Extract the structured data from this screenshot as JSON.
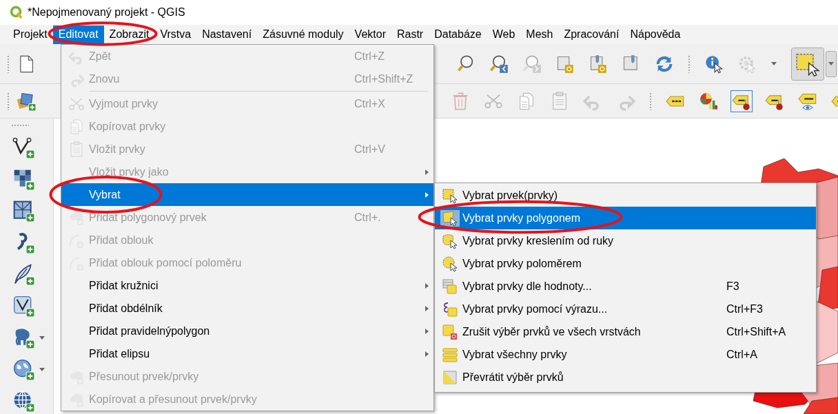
{
  "window": {
    "title": "*Nepojmenovaný projekt - QGIS"
  },
  "menubar": [
    {
      "label": "Projekt",
      "selected": false,
      "circled": false
    },
    {
      "label": "Editovat",
      "selected": true,
      "circled": true
    },
    {
      "label": "Zobrazit",
      "selected": false,
      "circled": false
    },
    {
      "label": "Vrstva",
      "selected": false,
      "circled": false
    },
    {
      "label": "Nastavení",
      "selected": false,
      "circled": false
    },
    {
      "label": "Zásuvné moduly",
      "selected": false,
      "circled": false
    },
    {
      "label": "Vektor",
      "selected": false,
      "circled": false
    },
    {
      "label": "Rastr",
      "selected": false,
      "circled": false
    },
    {
      "label": "Databáze",
      "selected": false,
      "circled": false
    },
    {
      "label": "Web",
      "selected": false,
      "circled": false
    },
    {
      "label": "Mesh",
      "selected": false,
      "circled": false
    },
    {
      "label": "Zpracování",
      "selected": false,
      "circled": false
    },
    {
      "label": "Nápověda",
      "selected": false,
      "circled": false
    }
  ],
  "edit_menu": {
    "items": [
      {
        "kind": "action",
        "label": "Zpět",
        "shortcut": "Ctrl+Z",
        "disabled": true,
        "submenu": false,
        "selected": false,
        "circled": false
      },
      {
        "kind": "action",
        "label": "Znovu",
        "shortcut": "Ctrl+Shift+Z",
        "disabled": true,
        "submenu": false,
        "selected": false,
        "circled": false
      },
      {
        "kind": "separator"
      },
      {
        "kind": "action",
        "label": "Vyjmout prvky",
        "shortcut": "Ctrl+X",
        "disabled": true,
        "submenu": false,
        "selected": false,
        "circled": false
      },
      {
        "kind": "action",
        "label": "Kopírovat prvky",
        "disabled": true,
        "submenu": false,
        "selected": false,
        "circled": false
      },
      {
        "kind": "action",
        "label": "Vložit prvky",
        "shortcut": "Ctrl+V",
        "disabled": true,
        "submenu": false,
        "selected": false,
        "circled": false
      },
      {
        "kind": "action",
        "label": "Vložit prvky jako",
        "disabled": true,
        "submenu": true,
        "selected": false,
        "circled": false
      },
      {
        "kind": "action",
        "label": "Vybrat",
        "disabled": false,
        "submenu": true,
        "selected": true,
        "circled": true
      },
      {
        "kind": "action",
        "label": "Přidat polygonový prvek",
        "shortcut": "Ctrl+.",
        "disabled": true,
        "submenu": false,
        "selected": false,
        "circled": false
      },
      {
        "kind": "action",
        "label": "Přidat oblouk",
        "disabled": true,
        "submenu": false,
        "selected": false,
        "circled": false
      },
      {
        "kind": "action",
        "label": "Přidat oblouk pomocí poloměru",
        "disabled": true,
        "submenu": false,
        "selected": false,
        "circled": false
      },
      {
        "kind": "action",
        "label": "Přidat kružnici",
        "disabled": false,
        "submenu": true,
        "selected": false,
        "circled": false
      },
      {
        "kind": "action",
        "label": "Přidat obdélník",
        "disabled": false,
        "submenu": true,
        "selected": false,
        "circled": false
      },
      {
        "kind": "action",
        "label": "Přidat pravidelnýpolygon",
        "disabled": false,
        "submenu": true,
        "selected": false,
        "circled": false
      },
      {
        "kind": "action",
        "label": "Přidat elipsu",
        "disabled": false,
        "submenu": true,
        "selected": false,
        "circled": false
      },
      {
        "kind": "action",
        "label": "Přesunout prvek/prvky",
        "disabled": true,
        "submenu": false,
        "selected": false,
        "circled": false
      },
      {
        "kind": "action",
        "label": "Kopírovat a přesunout prvek/prvky",
        "disabled": true,
        "submenu": false,
        "selected": false,
        "circled": false
      }
    ]
  },
  "select_submenu": {
    "items": [
      {
        "kind": "action",
        "label": "Vybrat prvek(prvky)",
        "disabled": false,
        "submenu": false,
        "selected": false,
        "circled": false
      },
      {
        "kind": "action",
        "label": "Vybrat prvky polygonem",
        "disabled": false,
        "submenu": false,
        "selected": true,
        "circled": true
      },
      {
        "kind": "action",
        "label": "Vybrat prvky kreslením od ruky",
        "disabled": false,
        "submenu": false,
        "selected": false,
        "circled": false
      },
      {
        "kind": "action",
        "label": "Vybrat prvky poloměrem",
        "disabled": false,
        "submenu": false,
        "selected": false,
        "circled": false
      },
      {
        "kind": "action",
        "label": "Vybrat prvky dle hodnoty...",
        "shortcut": "F3",
        "disabled": false,
        "submenu": false,
        "selected": false,
        "circled": false
      },
      {
        "kind": "action",
        "label": "Vybrat prvky pomocí výrazu...",
        "shortcut": "Ctrl+F3",
        "disabled": false,
        "submenu": false,
        "selected": false,
        "circled": false
      },
      {
        "kind": "action",
        "label": "Zrušit výběr prvků ve všech vrstvách",
        "shortcut": "Ctrl+Shift+A",
        "disabled": false,
        "submenu": false,
        "selected": false,
        "circled": false
      },
      {
        "kind": "action",
        "label": "Vybrat všechny prvky",
        "shortcut": "Ctrl+A",
        "disabled": false,
        "submenu": false,
        "selected": false,
        "circled": false
      },
      {
        "kind": "action",
        "label": "Převrátit výběr prvků",
        "disabled": false,
        "submenu": false,
        "selected": false,
        "circled": false
      }
    ]
  }
}
